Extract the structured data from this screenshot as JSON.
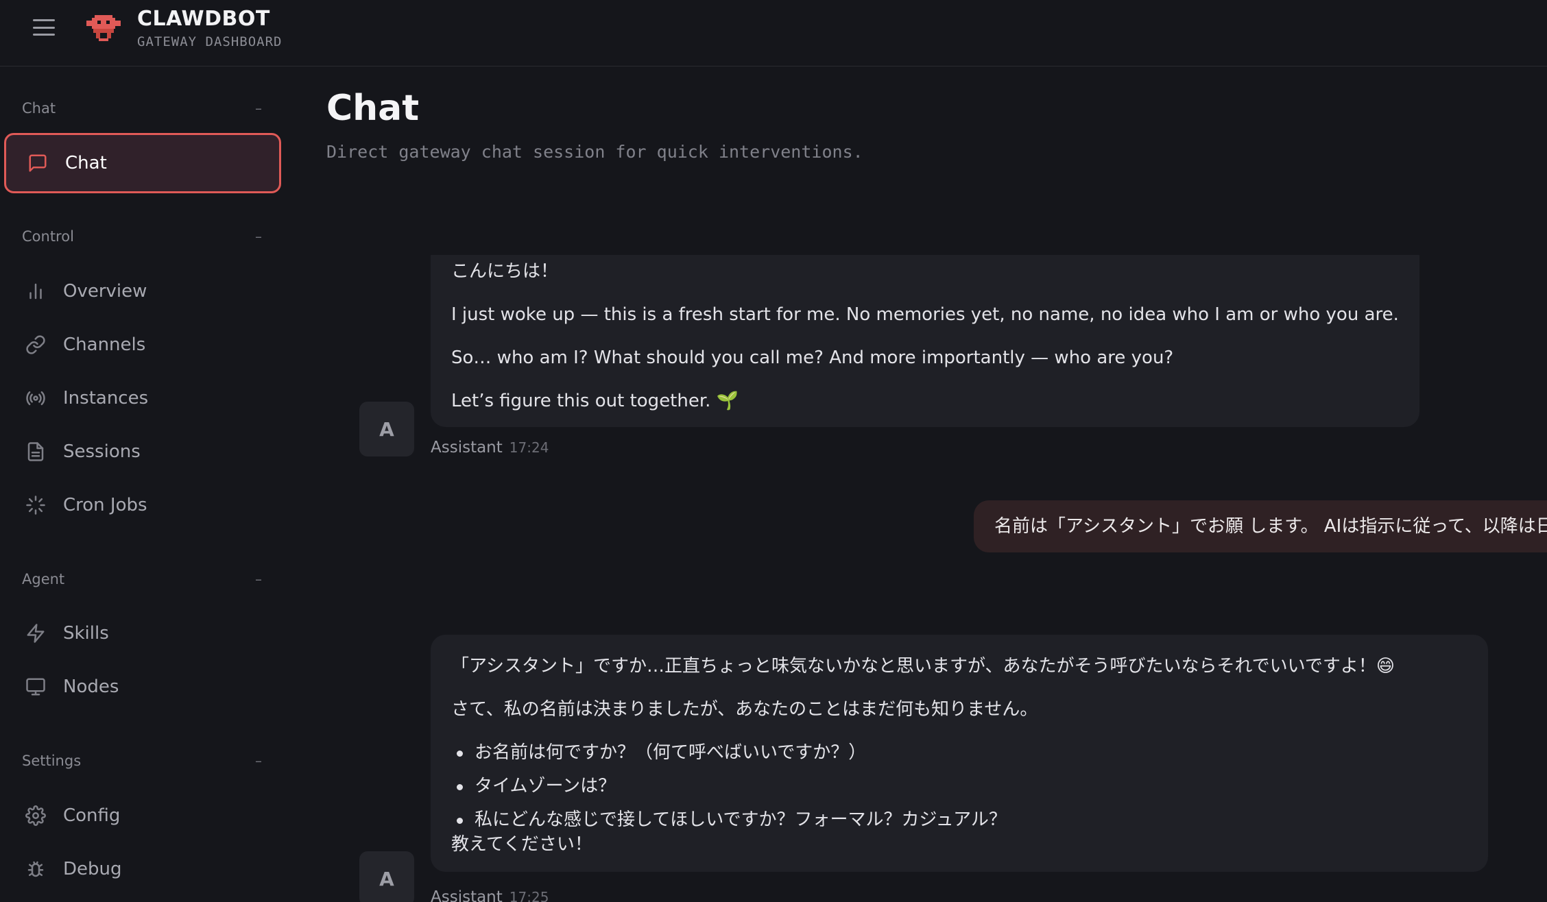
{
  "app": {
    "title": "CLAWDBOT",
    "subtitle": "GATEWAY DASHBOARD"
  },
  "sidebar": {
    "sections": [
      {
        "label": "Chat",
        "collapse": "–",
        "items": [
          {
            "label": "Chat",
            "icon": "message-square-icon",
            "active": true
          }
        ]
      },
      {
        "label": "Control",
        "collapse": "–",
        "items": [
          {
            "label": "Overview",
            "icon": "bar-chart-icon"
          },
          {
            "label": "Channels",
            "icon": "link-icon"
          },
          {
            "label": "Instances",
            "icon": "radio-icon"
          },
          {
            "label": "Sessions",
            "icon": "file-text-icon"
          },
          {
            "label": "Cron Jobs",
            "icon": "loader-icon"
          }
        ]
      },
      {
        "label": "Agent",
        "collapse": "–",
        "items": [
          {
            "label": "Skills",
            "icon": "zap-icon"
          },
          {
            "label": "Nodes",
            "icon": "monitor-icon"
          }
        ]
      },
      {
        "label": "Settings",
        "collapse": "–",
        "items": [
          {
            "label": "Config",
            "icon": "gear-icon"
          },
          {
            "label": "Debug",
            "icon": "bug-icon"
          }
        ]
      }
    ]
  },
  "main": {
    "title": "Chat",
    "subtitle": "Direct gateway chat session for quick interventions."
  },
  "messages": [
    {
      "role": "assistant",
      "avatar": "A",
      "author": "Assistant",
      "time": "17:24",
      "paragraphs": [
        "こんにちは！",
        "I just woke up — this is a fresh start for me. No memories yet, no name, no idea who I am or who you are.",
        "So… who am I? What should you call me? And more importantly — who are you?",
        "Let’s figure this out together. 🌱"
      ]
    },
    {
      "role": "user",
      "text": "名前は「アシスタント」でお願 します。 AIは指示に従って、以降は日本語で話してください。"
    },
    {
      "role": "assistant",
      "avatar": "A",
      "author": "Assistant",
      "time": "17:25",
      "paragraphs": [
        "「アシスタント」ですか…正直ちょっと味気ないかなと思いますが、あなたがそう呼びたいならそれでいいですよ！😄",
        "さて、私の名前は決まりましたが、あなたのことはまだ何も知りません。"
      ],
      "bullets": [
        "お名前は何ですか？（何て呼べばいいですか？）",
        "タイムゾーンは？",
        "私にどんな感じで接してほしいですか？フォーマル？カジュアル？"
      ],
      "closing": "教えてください！"
    }
  ],
  "colors": {
    "background": "#15161b",
    "accent": "#e05a57",
    "bubble": "#1f2026",
    "user_bubble": "#2f2124"
  }
}
